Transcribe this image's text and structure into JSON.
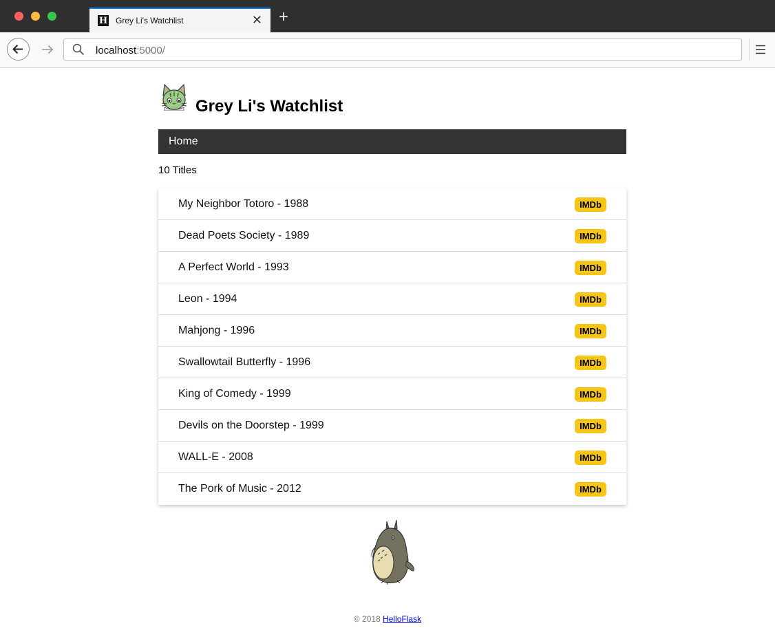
{
  "browser": {
    "tab_title": "Grey Li's Watchlist",
    "favicon_letter": "H",
    "url_host": "localhost",
    "url_rest": ":5000/",
    "new_tab_label": "+",
    "close_label": "✕"
  },
  "colors": {
    "nav_bg": "#333333",
    "imdb_badge": "#f5c518",
    "accent_tab": "#0a84ff"
  },
  "header": {
    "title": "Grey Li's Watchlist"
  },
  "nav": {
    "home_label": "Home"
  },
  "main": {
    "count_text": "10 Titles",
    "imdb_label": "IMDb",
    "movies": [
      {
        "title": "My Neighbor Totoro - 1988"
      },
      {
        "title": "Dead Poets Society - 1989"
      },
      {
        "title": "A Perfect World - 1993"
      },
      {
        "title": "Leon - 1994"
      },
      {
        "title": "Mahjong - 1996"
      },
      {
        "title": "Swallowtail Butterfly - 1996"
      },
      {
        "title": "King of Comedy - 1999"
      },
      {
        "title": "Devils on the Doorstep - 1999"
      },
      {
        "title": "WALL-E - 2008"
      },
      {
        "title": "The Pork of Music - 2012"
      }
    ]
  },
  "footer": {
    "copyright": "© 2018 ",
    "link_text": "HelloFlask"
  }
}
